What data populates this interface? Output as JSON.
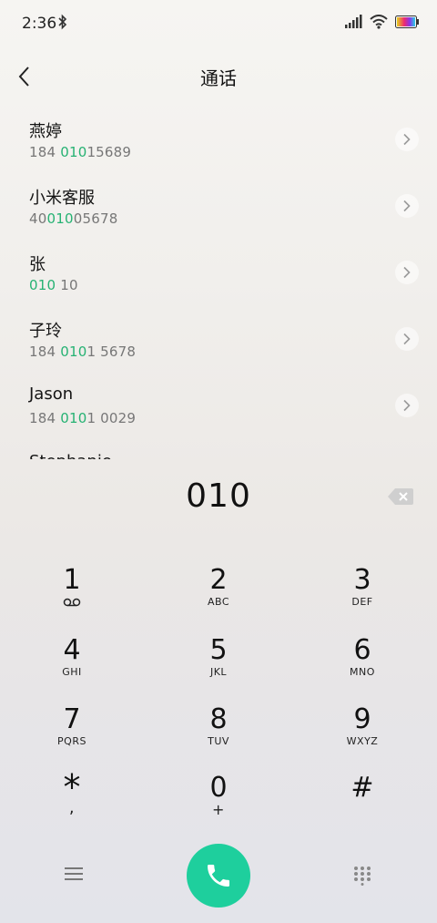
{
  "status": {
    "time": "2:36"
  },
  "header": {
    "title": "通话"
  },
  "contacts": [
    {
      "name": "燕婷",
      "number_parts": [
        "184 ",
        "010",
        "15689"
      ]
    },
    {
      "name": "小米客服",
      "number_parts": [
        "40",
        "010",
        "05678"
      ]
    },
    {
      "name": "张",
      "number_parts": [
        "",
        "010",
        " 10"
      ]
    },
    {
      "name": "子玲",
      "number_parts": [
        "184 ",
        "010",
        "1 5678"
      ]
    },
    {
      "name": "Jason",
      "number_parts": [
        "184 ",
        "010",
        "1 0029"
      ]
    }
  ],
  "partial_contact": "Stephanie",
  "dialer": {
    "entered": "010",
    "keys": [
      {
        "digit": "1",
        "letters": ""
      },
      {
        "digit": "2",
        "letters": "ABC"
      },
      {
        "digit": "3",
        "letters": "DEF"
      },
      {
        "digit": "4",
        "letters": "GHI"
      },
      {
        "digit": "5",
        "letters": "JKL"
      },
      {
        "digit": "6",
        "letters": "MNO"
      },
      {
        "digit": "7",
        "letters": "PQRS"
      },
      {
        "digit": "8",
        "letters": "TUV"
      },
      {
        "digit": "9",
        "letters": "WXYZ"
      },
      {
        "digit": "*",
        "letters": ","
      },
      {
        "digit": "0",
        "letters": "+"
      },
      {
        "digit": "#",
        "letters": ""
      }
    ]
  },
  "colors": {
    "accent": "#26b273",
    "call_button": "#1ecf9d"
  },
  "icons": [
    "bluetooth-icon",
    "signal-icon",
    "wifi-icon",
    "battery-icon",
    "back-icon",
    "chevron-right-icon",
    "backspace-icon",
    "voicemail-icon",
    "menu-icon",
    "phone-icon",
    "dialpad-icon"
  ]
}
